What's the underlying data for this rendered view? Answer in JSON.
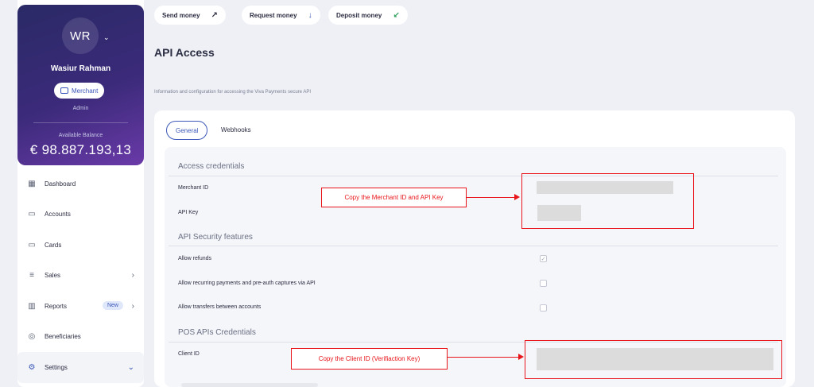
{
  "user": {
    "initials": "WR",
    "name": "Wasiur Rahman",
    "role_badge": "Merchant",
    "role_sub": "Admin",
    "balance_label": "Available Balance",
    "balance": "€ 98.887.193,13"
  },
  "nav": {
    "dashboard": "Dashboard",
    "accounts": "Accounts",
    "cards": "Cards",
    "sales": "Sales",
    "reports": "Reports",
    "reports_badge": "New",
    "beneficiaries": "Beneficiaries",
    "settings": "Settings"
  },
  "actions": {
    "send": "Send money",
    "request": "Request money",
    "deposit": "Deposit money"
  },
  "page": {
    "title": "API Access",
    "subtitle": "Information and configuration for accessing the Viva Payments secure API"
  },
  "tabs": {
    "general": "General",
    "webhooks": "Webhooks"
  },
  "sections": {
    "credentials": "Access credentials",
    "merchant_id": "Merchant ID",
    "api_key": "API Key",
    "security": "API Security features",
    "allow_refunds": "Allow refunds",
    "allow_recurring": "Allow recurring payments and pre-auth captures via API",
    "allow_transfers": "Allow transfers between accounts",
    "pos": "POS APIs Credentials",
    "client_id": "Client ID"
  },
  "checkboxes": {
    "refunds_mark": "✓"
  },
  "annotations": {
    "merchant_api": "Copy the Merchant ID and API Key",
    "client_id": "Copy the Client ID (Verifiaction Key)"
  },
  "colors": {
    "accent": "#3b57b7",
    "annotation": "#e8151b",
    "profile_gradient_start": "#2a2a66",
    "profile_gradient_end": "#6a3aa8"
  }
}
